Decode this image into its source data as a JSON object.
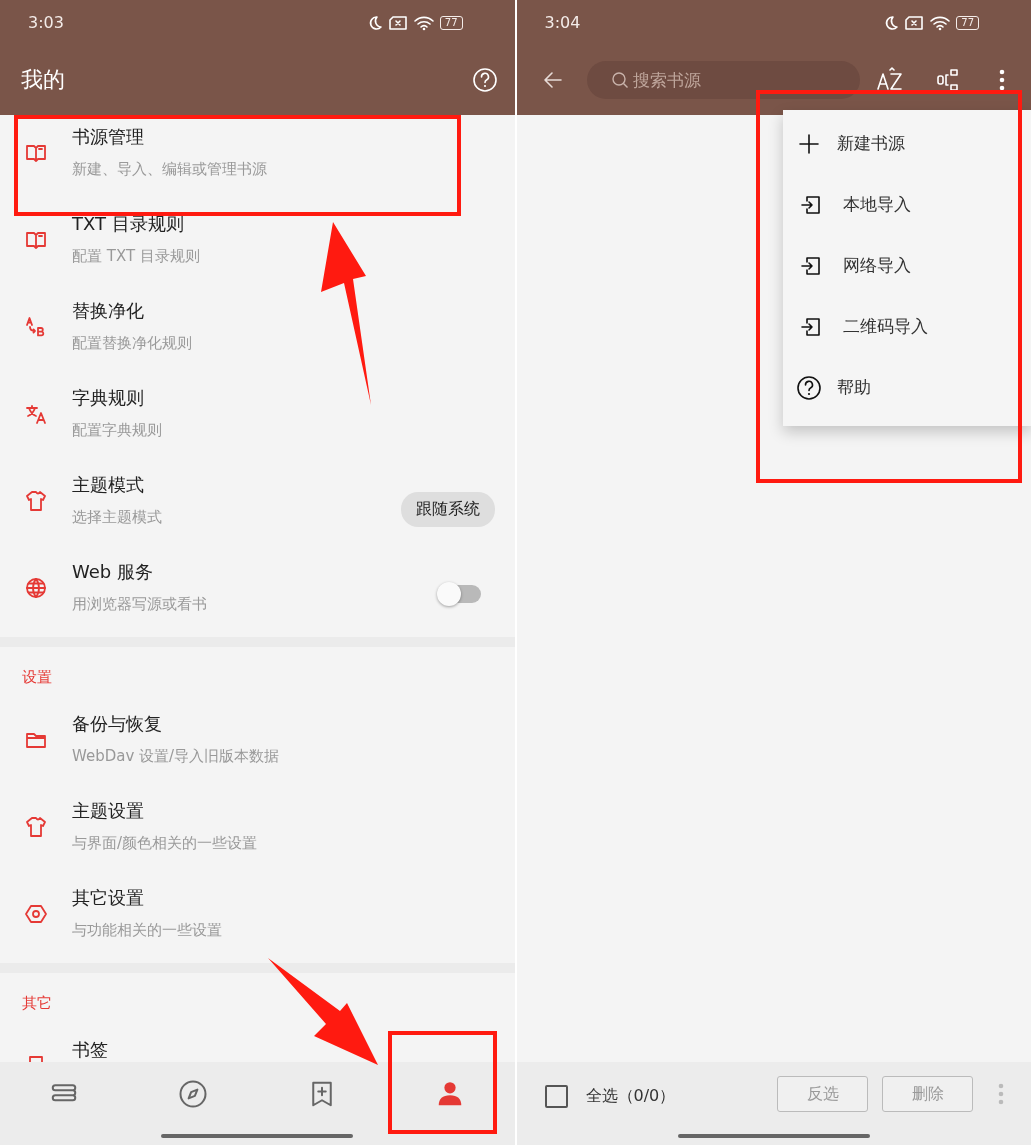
{
  "left": {
    "status_bar": {
      "time": "3:03",
      "battery": "77"
    },
    "app_bar": {
      "title": "我的"
    },
    "sections": [
      {
        "items": [
          {
            "title": "书源管理",
            "subtitle": "新建、导入、编辑或管理书源"
          },
          {
            "title": "TXT 目录规则",
            "subtitle": "配置 TXT 目录规则"
          },
          {
            "title": "替换净化",
            "subtitle": "配置替换净化规则"
          },
          {
            "title": "字典规则",
            "subtitle": "配置字典规则"
          },
          {
            "title": "主题模式",
            "subtitle": "选择主题模式",
            "trailing": {
              "kind": "chip",
              "label": "跟随系统"
            }
          },
          {
            "title": "Web 服务",
            "subtitle": "用浏览器写源或看书",
            "trailing": {
              "kind": "switch",
              "on": false
            }
          }
        ]
      },
      {
        "title": "设置",
        "items": [
          {
            "title": "备份与恢复",
            "subtitle": "WebDav 设置/导入旧版本数据"
          },
          {
            "title": "主题设置",
            "subtitle": "与界面/颜色相关的一些设置"
          },
          {
            "title": "其它设置",
            "subtitle": "与功能相关的一些设置"
          }
        ]
      },
      {
        "title": "其它",
        "items": [
          {
            "title": "书签"
          }
        ]
      }
    ],
    "bottom_nav": [
      {
        "selected": false
      },
      {
        "selected": false
      },
      {
        "selected": false
      },
      {
        "selected": true
      }
    ]
  },
  "right": {
    "status_bar": {
      "time": "3:04",
      "battery": "77"
    },
    "search": {
      "placeholder": "搜索书源"
    },
    "menu": [
      {
        "kind": "new",
        "label": "新建书源"
      },
      {
        "kind": "import",
        "label": "本地导入"
      },
      {
        "kind": "import",
        "label": "网络导入"
      },
      {
        "kind": "import",
        "label": "二维码导入"
      },
      {
        "kind": "help",
        "label": "帮助"
      }
    ],
    "bottom_bar": {
      "select_all": {
        "label": "全选（0/0）",
        "checked": false
      },
      "buttons": [
        {
          "label": "反选",
          "disabled": true
        },
        {
          "label": "删除",
          "disabled": true
        }
      ]
    }
  }
}
